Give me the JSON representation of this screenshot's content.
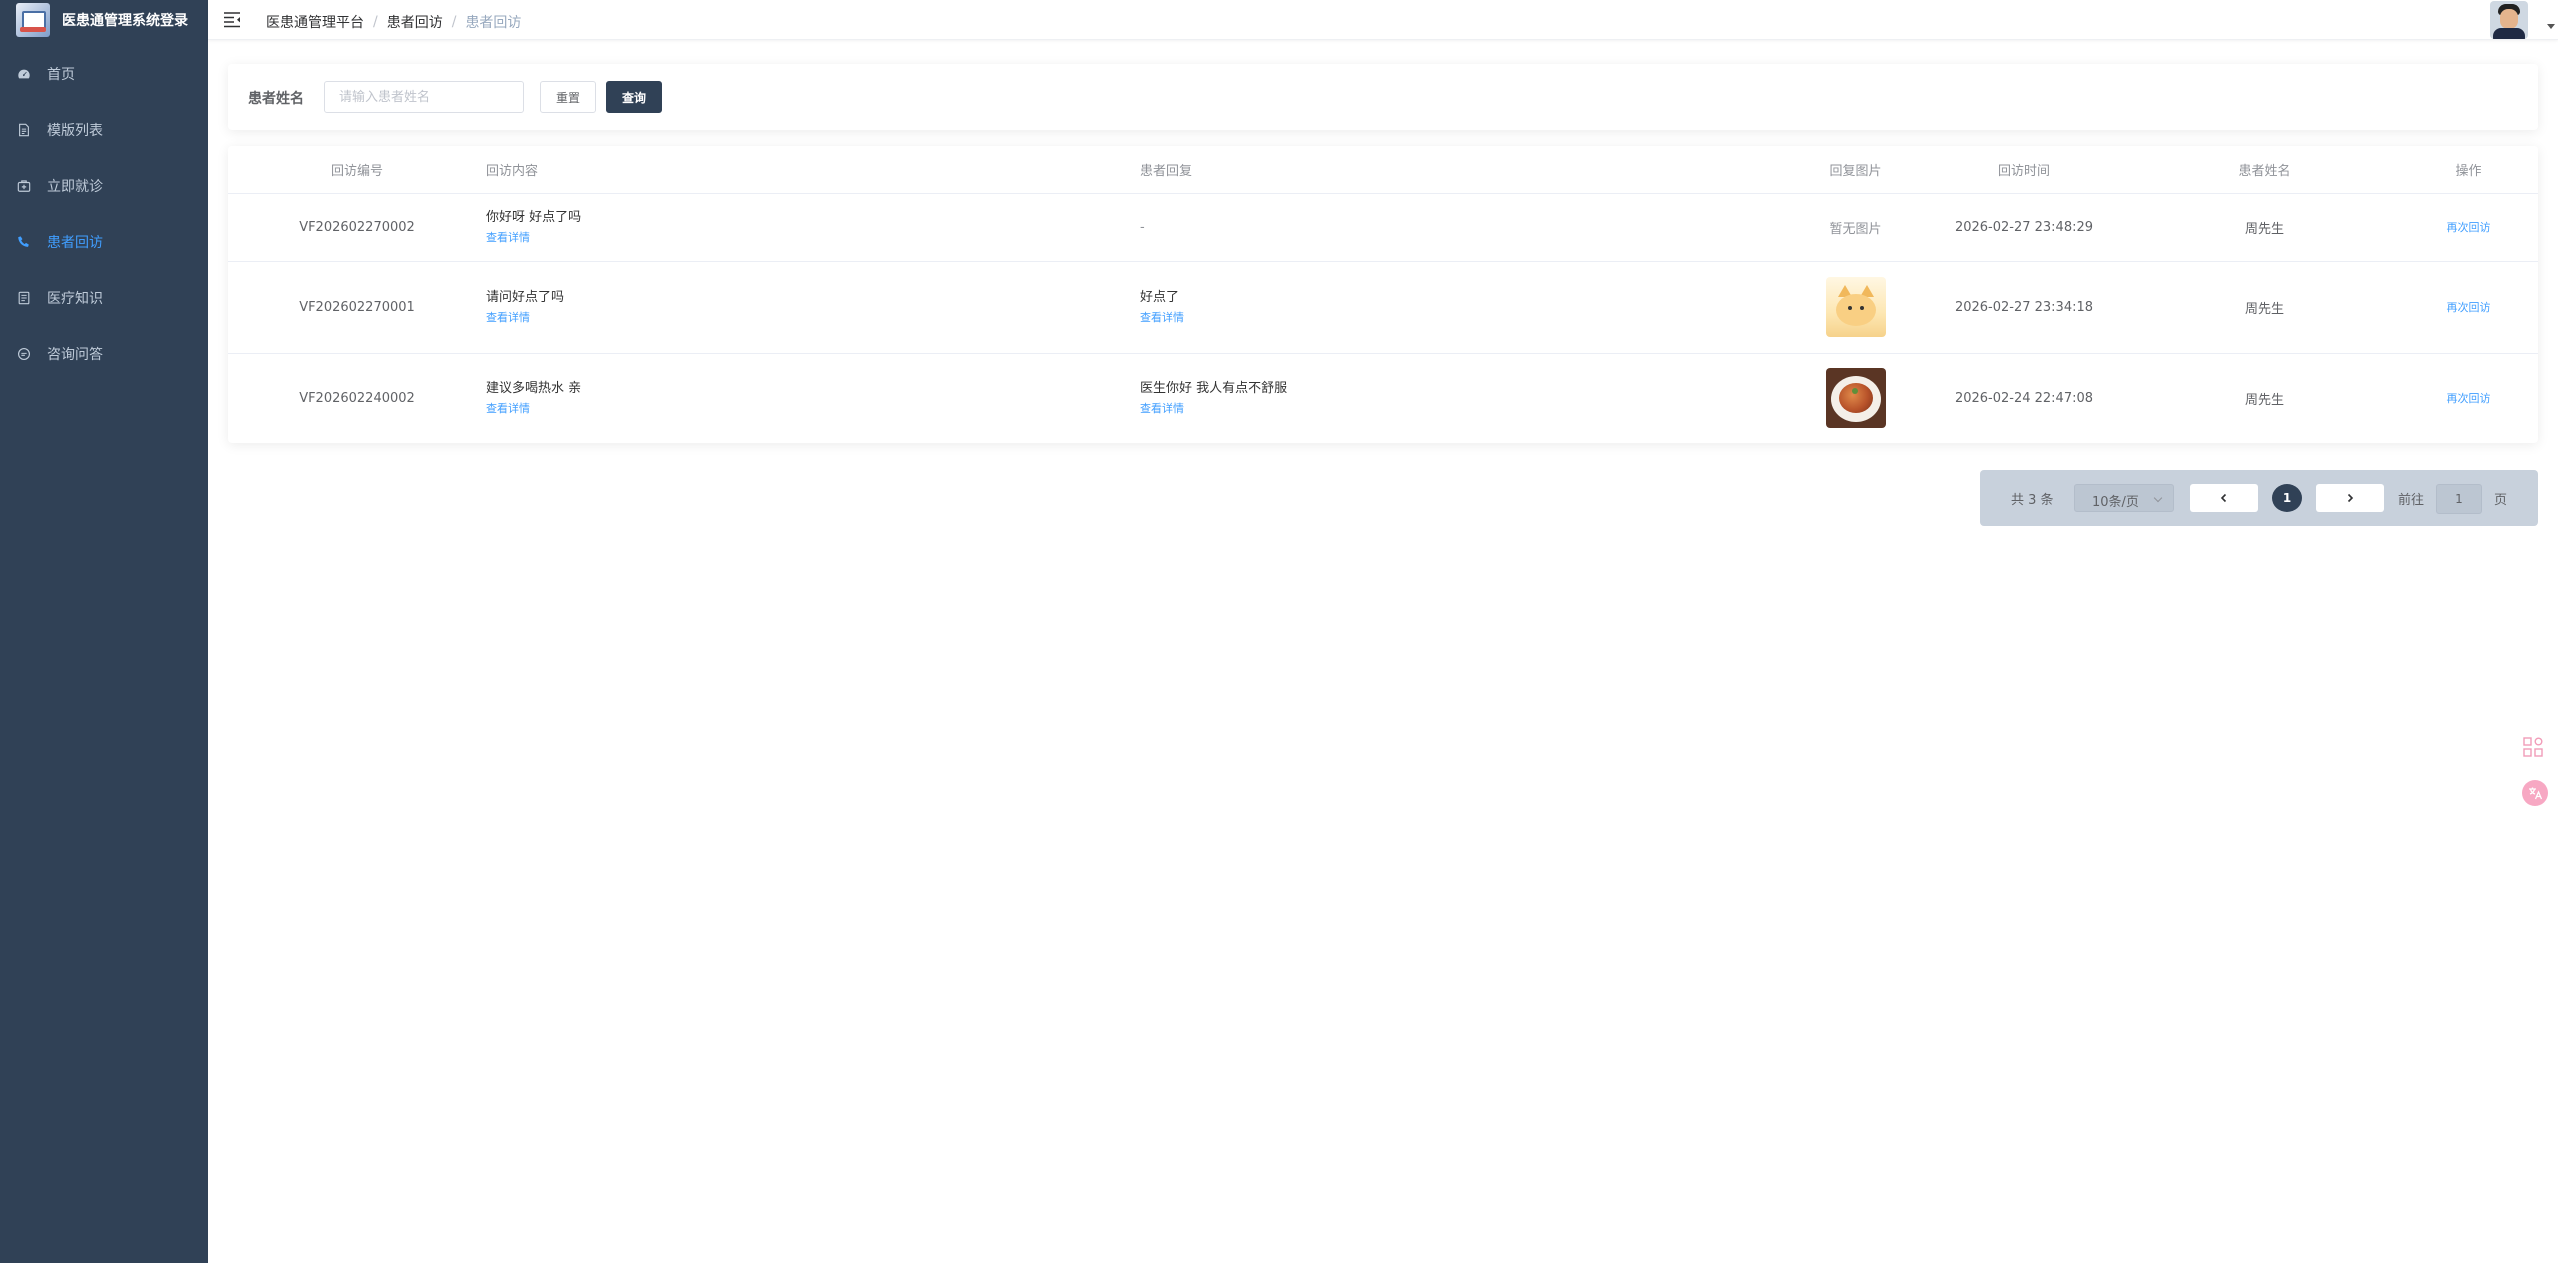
{
  "app": {
    "title": "医患通管理系统登录"
  },
  "sidebar": {
    "items": [
      {
        "label": "首页",
        "icon": "dashboard-icon"
      },
      {
        "label": "模版列表",
        "icon": "document-icon"
      },
      {
        "label": "立即就诊",
        "icon": "medical-case-icon"
      },
      {
        "label": "患者回访",
        "icon": "phone-icon",
        "active": true
      },
      {
        "label": "医疗知识",
        "icon": "book-icon"
      },
      {
        "label": "咨询问答",
        "icon": "chat-icon"
      }
    ]
  },
  "breadcrumb": [
    "医患通管理平台",
    "患者回访",
    "患者回访"
  ],
  "search": {
    "label": "患者姓名",
    "placeholder": "请输入患者姓名",
    "value": "",
    "reset_label": "重置",
    "query_label": "查询"
  },
  "table": {
    "headers": [
      "回访编号",
      "回访内容",
      "患者回复",
      "回复图片",
      "回访时间",
      "患者姓名",
      "操作"
    ],
    "detail_label": "查看详情",
    "rows": [
      {
        "id": "VF202602270002",
        "content": "你好呀 好点了吗",
        "reply": "-",
        "image": "暂无图片",
        "time": "2026-02-27 23:48:29",
        "name": "周先生",
        "action": "再次回访"
      },
      {
        "id": "VF202602270001",
        "content": "请问好点了吗",
        "reply": "好点了",
        "image": "cat-illustration",
        "time": "2026-02-27 23:34:18",
        "name": "周先生",
        "action": "再次回访"
      },
      {
        "id": "VF202602240002",
        "content": "建议多喝热水 亲",
        "reply": "医生你好 我人有点不舒服",
        "image": "food-photo",
        "time": "2026-02-24 22:47:08",
        "name": "周先生",
        "action": "再次回访"
      }
    ]
  },
  "pagination": {
    "total": "共 3 条",
    "page_size": "10条/页",
    "current_page": "1",
    "goto_label": "前往",
    "goto_value": "1",
    "page_suffix": "页"
  },
  "colors": {
    "sidebar_bg": "#304156",
    "active": "#409eff",
    "primary_button": "#304156"
  }
}
